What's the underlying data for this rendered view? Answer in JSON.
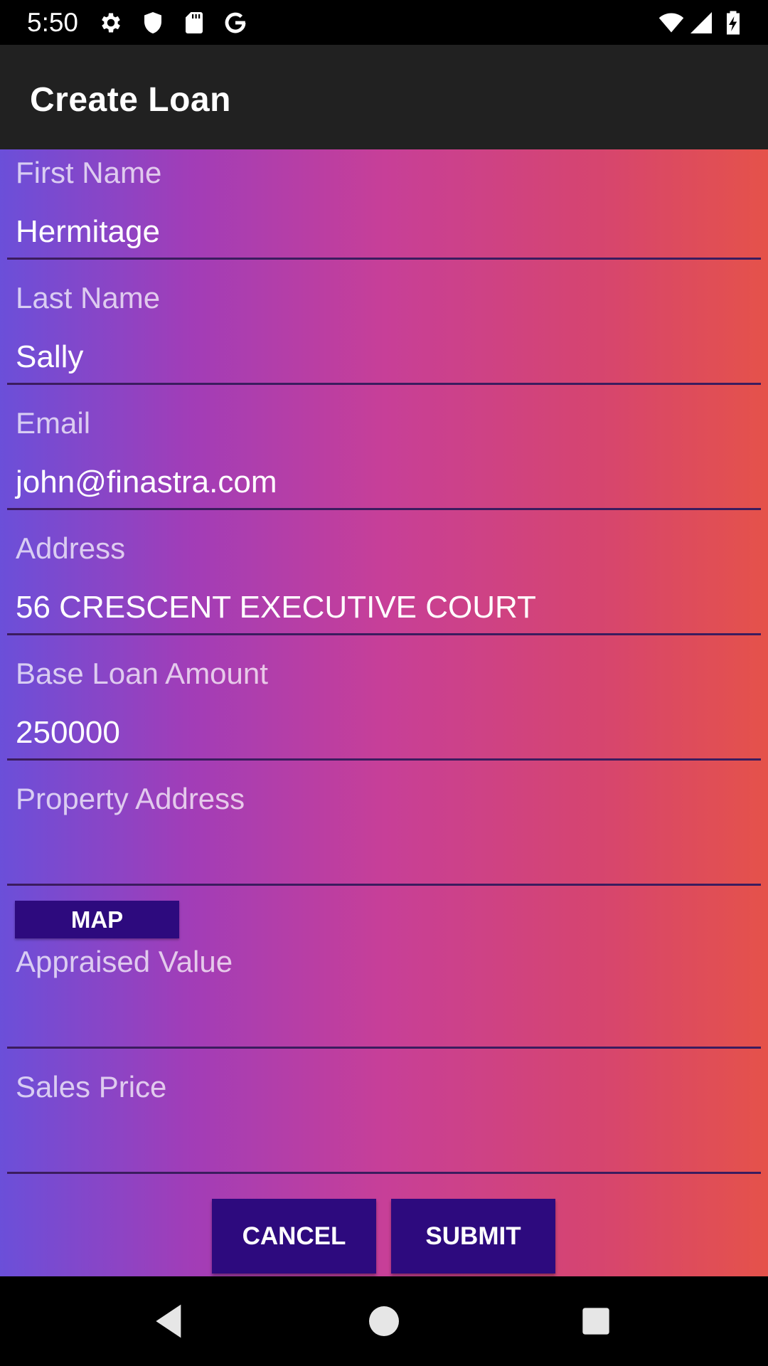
{
  "status_bar": {
    "time": "5:50",
    "left_icons": [
      "gear-icon",
      "shield-icon",
      "sd-card-icon",
      "google-icon"
    ],
    "right_icons": [
      "wifi-icon",
      "signal-icon",
      "battery-charging-icon"
    ]
  },
  "app_bar": {
    "title": "Create Loan"
  },
  "form": {
    "first_name": {
      "label": "First Name",
      "value": "Hermitage"
    },
    "last_name": {
      "label": "Last Name",
      "value": "Sally"
    },
    "email": {
      "label": "Email",
      "value": "john@finastra.com"
    },
    "address": {
      "label": "Address",
      "value": "56 CRESCENT EXECUTIVE COURT"
    },
    "base_loan_amount": {
      "label": "Base Loan Amount",
      "value": "250000"
    },
    "property_address": {
      "label": "Property Address",
      "value": ""
    },
    "map_button": "MAP",
    "appraised_value": {
      "label": "Appraised Value",
      "value": ""
    },
    "sales_price": {
      "label": "Sales Price",
      "value": ""
    }
  },
  "actions": {
    "cancel": "CANCEL",
    "submit": "SUBMIT"
  },
  "colors": {
    "status_bar": "#000000",
    "app_bar": "#212121",
    "gradient_start": "#6b4fd9",
    "gradient_end": "#e5524a",
    "button": "#2d0a7e"
  },
  "nav_bar": {
    "icons": [
      "back-icon",
      "home-icon",
      "recents-icon"
    ]
  }
}
